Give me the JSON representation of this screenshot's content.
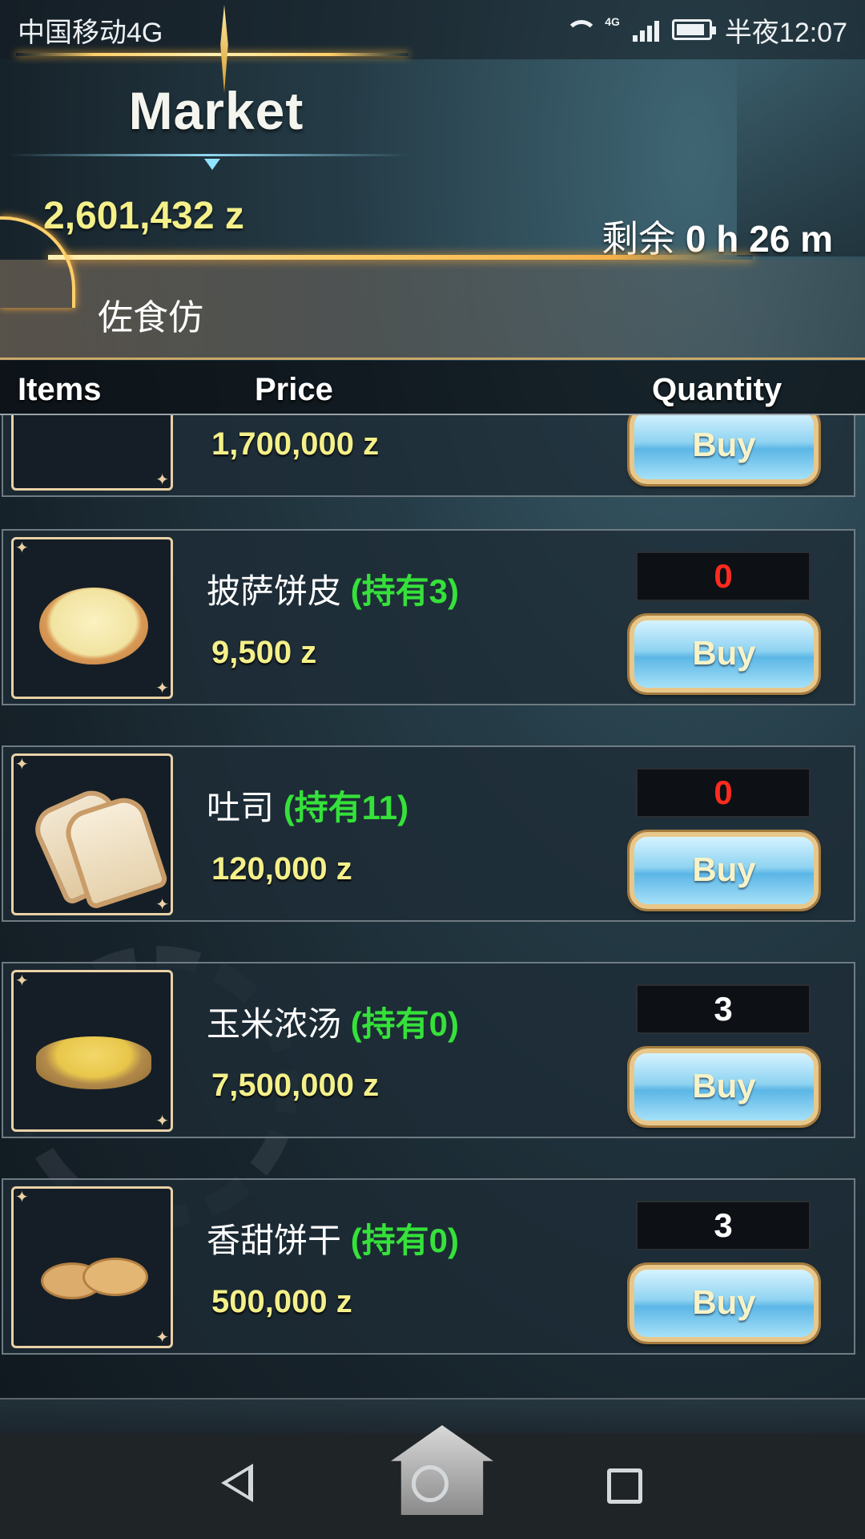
{
  "status_bar": {
    "carrier": "中国移动4G",
    "network_tag": "4G",
    "time": "半夜12:07",
    "icons": [
      "wifi-icon",
      "signal-icon",
      "battery-icon"
    ]
  },
  "header": {
    "title": "Market",
    "money": "2,601,432 z",
    "time_left_prefix": "剩余",
    "time_left": "0 h 26 m",
    "shop_name": "佐食仿"
  },
  "columns": {
    "items": "Items",
    "price": "Price",
    "quantity": "Quantity"
  },
  "items": [
    {
      "name": "",
      "owned": "",
      "price": "1,700,000 z",
      "quantity": "",
      "buy_label": "Buy",
      "icon": "stick-item-icon"
    },
    {
      "name": "披萨饼皮",
      "owned": "(持有3)",
      "price": "9,500 z",
      "quantity": "0",
      "buy_label": "Buy",
      "icon": "pizza-crust-icon"
    },
    {
      "name": "吐司",
      "owned": "(持有11)",
      "price": "120,000 z",
      "quantity": "0",
      "buy_label": "Buy",
      "icon": "toast-icon"
    },
    {
      "name": "玉米浓汤",
      "owned": "(持有0)",
      "price": "7,500,000 z",
      "quantity": "3",
      "buy_label": "Buy",
      "icon": "corn-soup-icon"
    },
    {
      "name": "香甜饼干",
      "owned": "(持有0)",
      "price": "500,000 z",
      "quantity": "3",
      "buy_label": "Buy",
      "icon": "cookie-icon"
    }
  ],
  "colors": {
    "price": "#f4f08a",
    "owned": "#35e13a",
    "qty_zero": "#ff2b1f",
    "gold_accent": "#ffcf6a"
  },
  "nav": {
    "icons": [
      "back-icon",
      "home-icon",
      "recent-apps-icon"
    ]
  }
}
